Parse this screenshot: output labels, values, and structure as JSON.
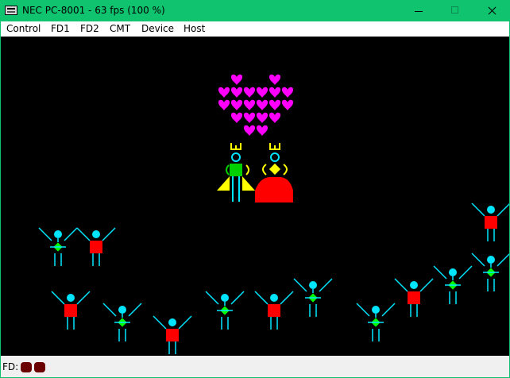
{
  "window": {
    "title": "NEC PC-8001 - 63 fps (100 %)"
  },
  "menu": [
    "Control",
    "FD1",
    "FD2",
    "CMT",
    "Device",
    "Host"
  ],
  "screen": {
    "heart_color": "#ff00ff",
    "figure_head_color": "#00e5ff",
    "figure_body_color": "#ff0000",
    "figure_diamond_color": "#00ff00",
    "crown_color": "#ffff00",
    "dress_color": "#ff0000",
    "dancer_count": 16
  },
  "status": {
    "fd_label": "FD:",
    "led_color": "#6b0000",
    "drive_count": 2
  }
}
